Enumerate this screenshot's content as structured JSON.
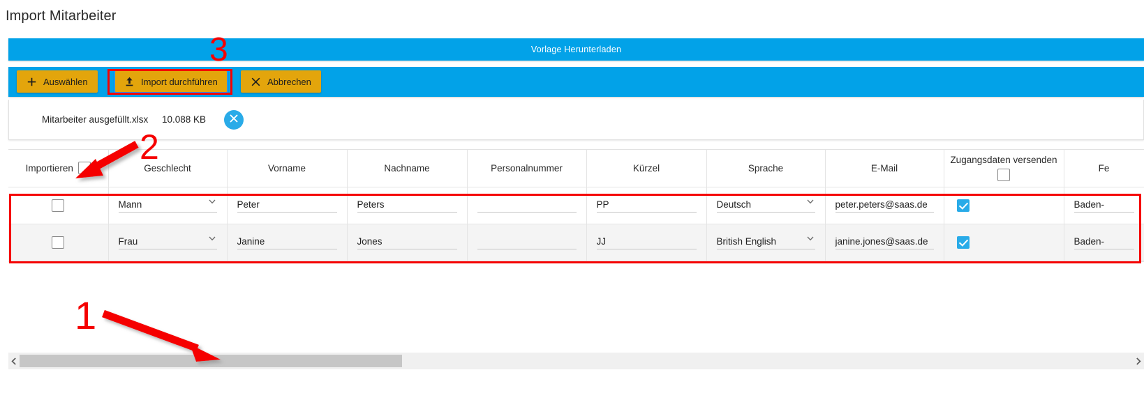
{
  "page": {
    "title": "Import Mitarbeiter"
  },
  "template_bar": {
    "label": "Vorlage Herunterladen"
  },
  "toolbar": {
    "select_label": "Auswählen",
    "select_icon": "plus-icon",
    "import_label": "Import durchführen",
    "import_icon": "upload-icon",
    "cancel_label": "Abbrechen",
    "cancel_icon": "close-x-icon"
  },
  "file": {
    "name": "Mitarbeiter ausgefüllt.xlsx",
    "size": "10.088 KB",
    "remove_icon": "close-circle-icon"
  },
  "table": {
    "columns": [
      {
        "key": "importieren",
        "label": "Importieren",
        "type": "checkbox-header"
      },
      {
        "key": "geschlecht",
        "label": "Geschlecht",
        "type": "select"
      },
      {
        "key": "vorname",
        "label": "Vorname",
        "type": "text"
      },
      {
        "key": "nachname",
        "label": "Nachname",
        "type": "text"
      },
      {
        "key": "personalnummer",
        "label": "Personalnummer",
        "type": "text"
      },
      {
        "key": "kuerzel",
        "label": "Kürzel",
        "type": "text"
      },
      {
        "key": "sprache",
        "label": "Sprache",
        "type": "select"
      },
      {
        "key": "email",
        "label": "E-Mail",
        "type": "text"
      },
      {
        "key": "zugangsdaten",
        "label": "Zugangsdaten versenden",
        "type": "checkbox-header"
      },
      {
        "key": "fe",
        "label": "Fe",
        "type": "text"
      }
    ],
    "header_select_all_checked": false,
    "header_zugangsdaten_checked": false,
    "rows": [
      {
        "importieren": false,
        "geschlecht": "Mann",
        "vorname": "Peter",
        "nachname": "Peters",
        "personalnummer": "",
        "kuerzel": "PP",
        "sprache": "Deutsch",
        "email": "peter.peters@saas.de",
        "zugangsdaten": true,
        "fe": "Baden-"
      },
      {
        "importieren": false,
        "geschlecht": "Frau",
        "vorname": "Janine",
        "nachname": "Jones",
        "personalnummer": "",
        "kuerzel": "JJ",
        "sprache": "British English",
        "email": "janine.jones@saas.de",
        "zugangsdaten": true,
        "fe": "Baden-"
      }
    ]
  },
  "scrollbar": {
    "left_arrow_icon": "chevron-left-icon",
    "right_arrow_icon": "chevron-right-icon"
  },
  "annotations": [
    {
      "id": "1",
      "label": "1",
      "target": "horizontal-scrollbar"
    },
    {
      "id": "2",
      "label": "2",
      "target": "select-all-import-checkbox"
    },
    {
      "id": "3",
      "label": "3",
      "target": "import-durchfuehren-button"
    }
  ],
  "colors": {
    "accent_blue": "#02A2E8",
    "button_amber": "#E3A50C",
    "annotation_red": "#f50000",
    "checkbox_checked": "#29ABE8"
  }
}
